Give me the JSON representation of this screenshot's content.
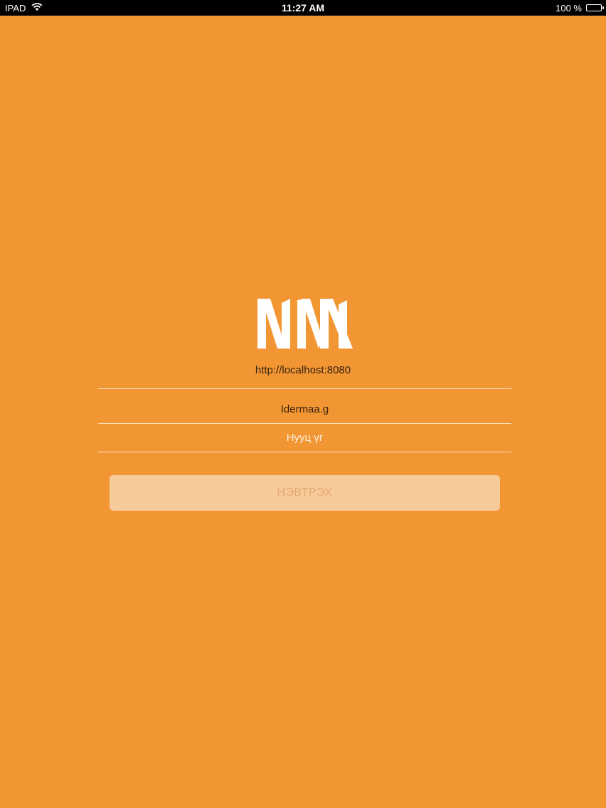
{
  "status_bar": {
    "device": "IPAD",
    "time": "11:27 AM",
    "battery": "100 %",
    "battery_level": 1.0
  },
  "login": {
    "logo_text": "NM",
    "server_url": "http://localhost:8080",
    "username_value": "Idermaa.g",
    "password_placeholder": "Нууц үг",
    "login_button_label": "НЭВТРЭХ"
  },
  "colors": {
    "background": "#F29634",
    "button_bg": "#F7CA99",
    "button_text": "#E4A977",
    "divider": "#FBE2C4"
  },
  "icons": {
    "wifi": "wifi-icon",
    "battery": "battery-icon",
    "logo": "nm-logo"
  }
}
